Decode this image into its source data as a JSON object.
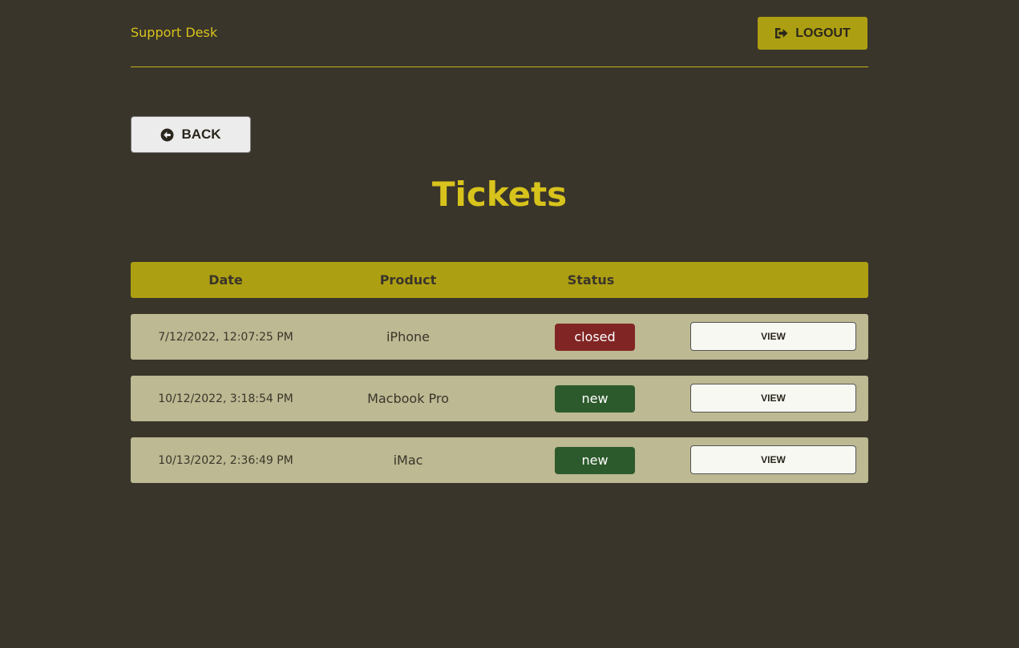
{
  "header": {
    "brand": "Support Desk",
    "logout_label": "LOGOUT",
    "logout_icon": "sign-out-icon"
  },
  "back_button": {
    "label": "BACK",
    "icon": "arrow-circle-left-icon"
  },
  "page_title": "Tickets",
  "table": {
    "columns": [
      "Date",
      "Product",
      "Status"
    ],
    "rows": [
      {
        "date": "7/12/2022, 12:07:25 PM",
        "product": "iPhone",
        "status": "closed",
        "action": "VIEW"
      },
      {
        "date": "10/12/2022, 3:18:54 PM",
        "product": "Macbook Pro",
        "status": "new",
        "action": "VIEW"
      },
      {
        "date": "10/13/2022, 2:36:49 PM",
        "product": "iMac",
        "status": "new",
        "action": "VIEW"
      }
    ]
  },
  "colors": {
    "background": "#3a352a",
    "accent": "#ad9f12",
    "title": "#d8c31c",
    "row_background": "#bcb993",
    "status_closed": "#812524",
    "status_new": "#2d5a2c"
  }
}
